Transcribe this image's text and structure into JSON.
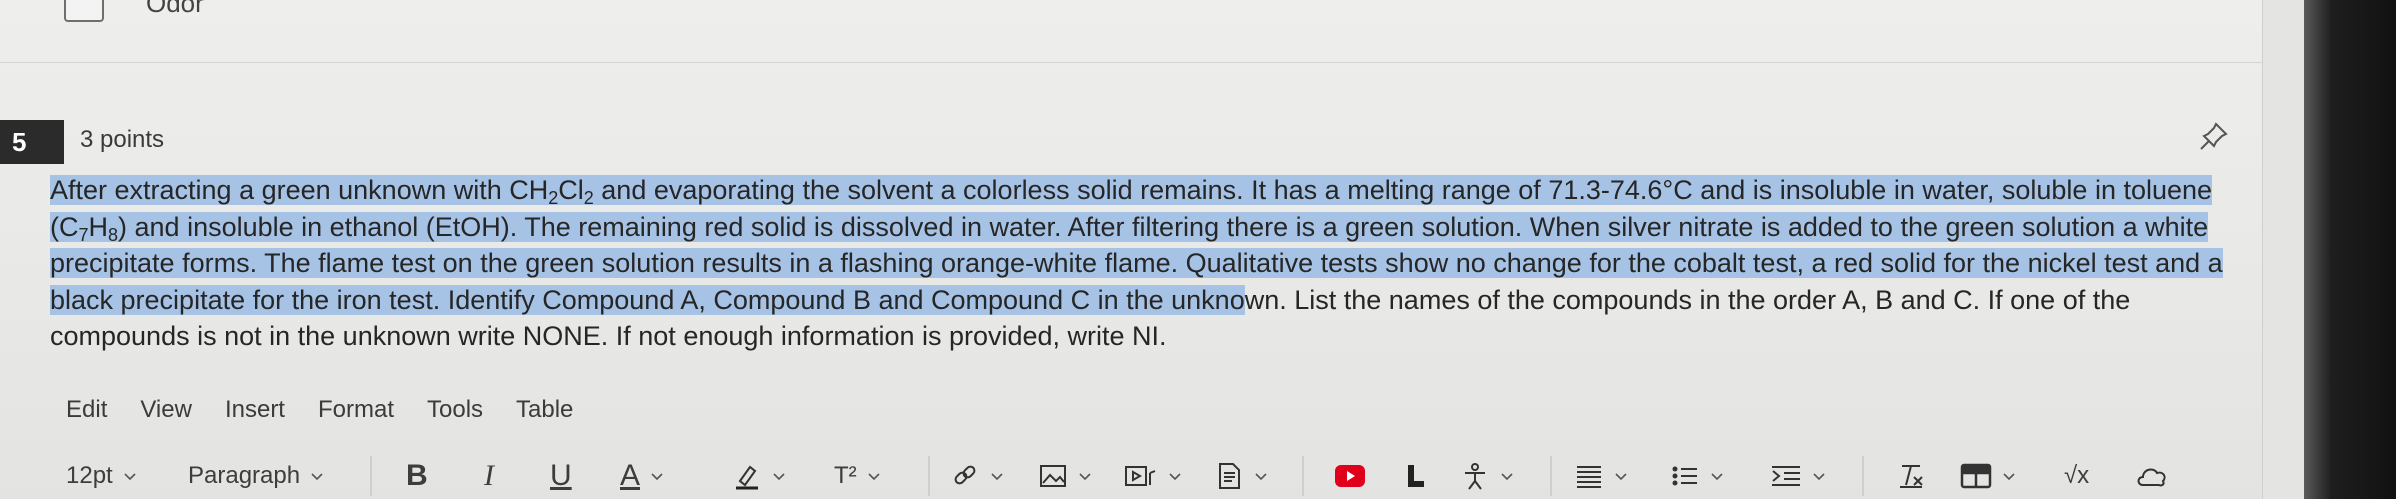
{
  "previous": {
    "option_label": "Odor"
  },
  "question": {
    "number": "5",
    "points": "3 points",
    "text": {
      "seg1": "After extracting a green unknown with CH",
      "sub_a": "2",
      "seg2": "Cl",
      "sub_b": "2",
      "seg3": " and evaporating the solvent a colorless solid remains. It has a melting range of 71.3-74.6°C and is insoluble in water, soluble in toluene (C",
      "sub_c": "7",
      "seg4": "H",
      "sub_d": "8",
      "seg5": ") and insoluble in ethanol (EtOH). The remaining red solid is dissolved in water. After filtering there is a green solution. When silver nitrate is added to the green solution a white precipitate forms. The flame test on the green solution results in a flashing orange-white flame. Qualitative tests show no change for the cobalt test, a red solid for the nickel test and a black precipitate for the iron test. Identify Compound A, Compound B and Compound C in the unkno",
      "seg6": "wn. List the names of the compounds in the order A, B and C. If one of the compounds is not in the unknown write NONE. If not enough information is provided, write NI."
    }
  },
  "editor": {
    "menu": [
      "Edit",
      "View",
      "Insert",
      "Format",
      "Tools",
      "Table"
    ],
    "font_size": "12pt",
    "block_format": "Paragraph",
    "bold": "B",
    "italic": "I",
    "underline": "U",
    "text_color": "A",
    "superscript": "T²",
    "sqrt": "√x",
    "icons": [
      "pin-icon",
      "chevron-down-icon",
      "highlighter-icon",
      "link-icon",
      "image-icon",
      "media-icon",
      "document-icon",
      "youtube-icon",
      "external-tool-icon",
      "accessibility-icon",
      "align-icon",
      "bullet-list-icon",
      "indent-icon",
      "clear-format-icon",
      "table-icon",
      "cloud-icon"
    ],
    "colors": {
      "selection": "#a6c3e6",
      "youtube": "#e0001b",
      "accent_text": "#2f2f2f"
    }
  }
}
